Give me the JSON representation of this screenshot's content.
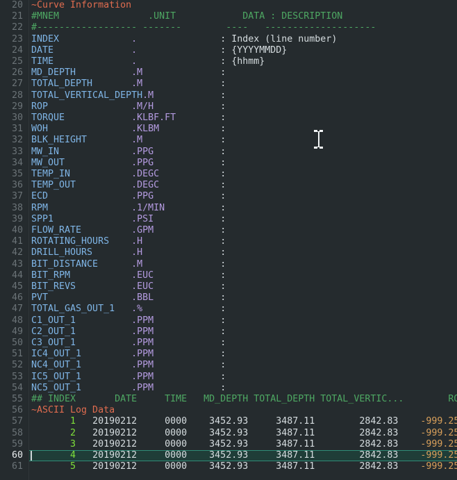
{
  "editor": {
    "theme": "dark",
    "background_color": "#252b2e",
    "gutter_color": "#6b7377",
    "active_line_number": 60,
    "active_line_bg": "#1f3d38",
    "active_line_border": "#2f8d78",
    "colors": {
      "section_header": "#e06c4f",
      "comment": "#4ea863",
      "mnemonic": "#7fb5e6",
      "unit": "#b49be0",
      "plain": "#d6dde0",
      "index_number": "#7ee03a",
      "null_value": "#d9a05b"
    },
    "mouse_cursor": "i-beam-text-cursor"
  },
  "lines": [
    {
      "n": 20,
      "segs": [
        {
          "c": "head",
          "t": "~Curve Information"
        }
      ]
    },
    {
      "n": 21,
      "segs": [
        {
          "c": "comment",
          "t": "#MNEM                .UNIT            DATA : DESCRIPTION"
        }
      ]
    },
    {
      "n": 22,
      "segs": [
        {
          "c": "comment",
          "t": "#------------------ -------        ----   --------------------"
        }
      ]
    },
    {
      "n": 23,
      "segs": [
        {
          "c": "mnem",
          "t": "INDEX             "
        },
        {
          "c": "unit",
          "t": "."
        },
        {
          "c": "plain",
          "t": "               : Index (line number)"
        }
      ]
    },
    {
      "n": 24,
      "segs": [
        {
          "c": "mnem",
          "t": "DATE              "
        },
        {
          "c": "unit",
          "t": "."
        },
        {
          "c": "plain",
          "t": "               : {YYYYMMDD}"
        }
      ]
    },
    {
      "n": 25,
      "segs": [
        {
          "c": "mnem",
          "t": "TIME              "
        },
        {
          "c": "unit",
          "t": "."
        },
        {
          "c": "plain",
          "t": "               : {hhmm}"
        }
      ]
    },
    {
      "n": 26,
      "segs": [
        {
          "c": "mnem",
          "t": "MD_DEPTH          "
        },
        {
          "c": "unit",
          "t": ".M"
        },
        {
          "c": "plain",
          "t": "              :"
        }
      ]
    },
    {
      "n": 27,
      "segs": [
        {
          "c": "mnem",
          "t": "TOTAL_DEPTH       "
        },
        {
          "c": "unit",
          "t": ".M"
        },
        {
          "c": "plain",
          "t": "              :"
        }
      ]
    },
    {
      "n": 28,
      "segs": [
        {
          "c": "mnem",
          "t": "TOTAL_VERTICAL_DEPTH"
        },
        {
          "c": "unit",
          "t": ".M"
        },
        {
          "c": "plain",
          "t": "            :"
        }
      ]
    },
    {
      "n": 29,
      "segs": [
        {
          "c": "mnem",
          "t": "ROP               "
        },
        {
          "c": "unit",
          "t": ".M/H"
        },
        {
          "c": "plain",
          "t": "            :"
        }
      ]
    },
    {
      "n": 30,
      "segs": [
        {
          "c": "mnem",
          "t": "TORQUE            "
        },
        {
          "c": "unit",
          "t": ".KLBF.FT"
        },
        {
          "c": "plain",
          "t": "        :"
        }
      ]
    },
    {
      "n": 31,
      "segs": [
        {
          "c": "mnem",
          "t": "WOH               "
        },
        {
          "c": "unit",
          "t": ".KLBM"
        },
        {
          "c": "plain",
          "t": "           :"
        }
      ]
    },
    {
      "n": 32,
      "segs": [
        {
          "c": "mnem",
          "t": "BLK_HEIGHT        "
        },
        {
          "c": "unit",
          "t": ".M"
        },
        {
          "c": "plain",
          "t": "              :"
        }
      ]
    },
    {
      "n": 33,
      "segs": [
        {
          "c": "mnem",
          "t": "MW_IN             "
        },
        {
          "c": "unit",
          "t": ".PPG"
        },
        {
          "c": "plain",
          "t": "            :"
        }
      ]
    },
    {
      "n": 34,
      "segs": [
        {
          "c": "mnem",
          "t": "MW_OUT            "
        },
        {
          "c": "unit",
          "t": ".PPG"
        },
        {
          "c": "plain",
          "t": "            :"
        }
      ]
    },
    {
      "n": 35,
      "segs": [
        {
          "c": "mnem",
          "t": "TEMP_IN           "
        },
        {
          "c": "unit",
          "t": ".DEGC"
        },
        {
          "c": "plain",
          "t": "           :"
        }
      ]
    },
    {
      "n": 36,
      "segs": [
        {
          "c": "mnem",
          "t": "TEMP_OUT          "
        },
        {
          "c": "unit",
          "t": ".DEGC"
        },
        {
          "c": "plain",
          "t": "           :"
        }
      ]
    },
    {
      "n": 37,
      "segs": [
        {
          "c": "mnem",
          "t": "ECD               "
        },
        {
          "c": "unit",
          "t": ".PPG"
        },
        {
          "c": "plain",
          "t": "            :"
        }
      ]
    },
    {
      "n": 38,
      "segs": [
        {
          "c": "mnem",
          "t": "RPM               "
        },
        {
          "c": "unit",
          "t": ".1/MIN"
        },
        {
          "c": "plain",
          "t": "          :"
        }
      ]
    },
    {
      "n": 39,
      "segs": [
        {
          "c": "mnem",
          "t": "SPP1              "
        },
        {
          "c": "unit",
          "t": ".PSI"
        },
        {
          "c": "plain",
          "t": "            :"
        }
      ]
    },
    {
      "n": 40,
      "segs": [
        {
          "c": "mnem",
          "t": "FLOW_RATE         "
        },
        {
          "c": "unit",
          "t": ".GPM"
        },
        {
          "c": "plain",
          "t": "            :"
        }
      ]
    },
    {
      "n": 41,
      "segs": [
        {
          "c": "mnem",
          "t": "ROTATING_HOURS    "
        },
        {
          "c": "unit",
          "t": ".H"
        },
        {
          "c": "plain",
          "t": "              :"
        }
      ]
    },
    {
      "n": 42,
      "segs": [
        {
          "c": "mnem",
          "t": "DRILL_HOURS       "
        },
        {
          "c": "unit",
          "t": ".H"
        },
        {
          "c": "plain",
          "t": "              :"
        }
      ]
    },
    {
      "n": 43,
      "segs": [
        {
          "c": "mnem",
          "t": "BIT_DISTANCE      "
        },
        {
          "c": "unit",
          "t": ".M"
        },
        {
          "c": "plain",
          "t": "              :"
        }
      ]
    },
    {
      "n": 44,
      "segs": [
        {
          "c": "mnem",
          "t": "BIT_RPM           "
        },
        {
          "c": "unit",
          "t": ".EUC"
        },
        {
          "c": "plain",
          "t": "            :"
        }
      ]
    },
    {
      "n": 45,
      "segs": [
        {
          "c": "mnem",
          "t": "BIT_REVS          "
        },
        {
          "c": "unit",
          "t": ".EUC"
        },
        {
          "c": "plain",
          "t": "            :"
        }
      ]
    },
    {
      "n": 46,
      "segs": [
        {
          "c": "mnem",
          "t": "PVT               "
        },
        {
          "c": "unit",
          "t": ".BBL"
        },
        {
          "c": "plain",
          "t": "            :"
        }
      ]
    },
    {
      "n": 47,
      "segs": [
        {
          "c": "mnem",
          "t": "TOTAL_GAS_OUT_1   "
        },
        {
          "c": "unit",
          "t": ".%"
        },
        {
          "c": "plain",
          "t": "              :"
        }
      ]
    },
    {
      "n": 48,
      "segs": [
        {
          "c": "mnem",
          "t": "C1_OUT_1          "
        },
        {
          "c": "unit",
          "t": ".PPM"
        },
        {
          "c": "plain",
          "t": "            :"
        }
      ]
    },
    {
      "n": 49,
      "segs": [
        {
          "c": "mnem",
          "t": "C2_OUT_1          "
        },
        {
          "c": "unit",
          "t": ".PPM"
        },
        {
          "c": "plain",
          "t": "            :"
        }
      ]
    },
    {
      "n": 50,
      "segs": [
        {
          "c": "mnem",
          "t": "C3_OUT_1          "
        },
        {
          "c": "unit",
          "t": ".PPM"
        },
        {
          "c": "plain",
          "t": "            :"
        }
      ]
    },
    {
      "n": 51,
      "segs": [
        {
          "c": "mnem",
          "t": "IC4_OUT_1         "
        },
        {
          "c": "unit",
          "t": ".PPM"
        },
        {
          "c": "plain",
          "t": "            :"
        }
      ]
    },
    {
      "n": 52,
      "segs": [
        {
          "c": "mnem",
          "t": "NC4_OUT_1         "
        },
        {
          "c": "unit",
          "t": ".PPM"
        },
        {
          "c": "plain",
          "t": "            :"
        }
      ]
    },
    {
      "n": 53,
      "segs": [
        {
          "c": "mnem",
          "t": "IC5_OUT_1         "
        },
        {
          "c": "unit",
          "t": ".PPM"
        },
        {
          "c": "plain",
          "t": "            :"
        }
      ]
    },
    {
      "n": 54,
      "segs": [
        {
          "c": "mnem",
          "t": "NC5_OUT_1         "
        },
        {
          "c": "unit",
          "t": ".PPM"
        },
        {
          "c": "plain",
          "t": "            :"
        }
      ]
    },
    {
      "n": 55,
      "segs": [
        {
          "c": "comment",
          "t": "## INDEX       DATE     TIME   MD_DEPTH TOTAL_DEPTH TOTAL_VERTIC...        ROP"
        }
      ]
    },
    {
      "n": 56,
      "segs": [
        {
          "c": "head",
          "t": "~ASCII Log Data"
        }
      ]
    },
    {
      "n": 57,
      "segs": [
        {
          "c": "green",
          "t": "       1"
        },
        {
          "c": "plain",
          "t": "   20190212     0000    3452.93     3487.11        2842.83    "
        },
        {
          "c": "num",
          "t": "-999.25"
        }
      ]
    },
    {
      "n": 58,
      "segs": [
        {
          "c": "green",
          "t": "       2"
        },
        {
          "c": "plain",
          "t": "   20190212     0000    3452.93     3487.11        2842.83    "
        },
        {
          "c": "num",
          "t": "-999.25"
        }
      ]
    },
    {
      "n": 59,
      "segs": [
        {
          "c": "green",
          "t": "       3"
        },
        {
          "c": "plain",
          "t": "   20190212     0000    3452.93     3487.11        2842.83    "
        },
        {
          "c": "num",
          "t": "-999.25"
        }
      ]
    },
    {
      "n": 60,
      "active": true,
      "segs": [
        {
          "c": "green",
          "t": "       4"
        },
        {
          "c": "plain",
          "t": "   20190212     0000    3452.93     3487.11        2842.83    "
        },
        {
          "c": "num",
          "t": "-999.25"
        }
      ]
    },
    {
      "n": 61,
      "segs": [
        {
          "c": "green",
          "t": "       5"
        },
        {
          "c": "plain",
          "t": "   20190212     0000    3452.93     3487.11        2842.83    "
        },
        {
          "c": "num",
          "t": "-999.25"
        }
      ]
    }
  ],
  "las_content": {
    "section": "~Curve Information",
    "header_row": {
      "mnem": "#MNEM",
      "unit": ".UNIT",
      "data": "DATA",
      "colon": ":",
      "description": "DESCRIPTION"
    },
    "curves": [
      {
        "mnemonic": "INDEX",
        "unit": ".",
        "description": "Index (line number)"
      },
      {
        "mnemonic": "DATE",
        "unit": ".",
        "description": "{YYYYMMDD}"
      },
      {
        "mnemonic": "TIME",
        "unit": ".",
        "description": "{hhmm}"
      },
      {
        "mnemonic": "MD_DEPTH",
        "unit": ".M",
        "description": ""
      },
      {
        "mnemonic": "TOTAL_DEPTH",
        "unit": ".M",
        "description": ""
      },
      {
        "mnemonic": "TOTAL_VERTICAL_DEPTH",
        "unit": ".M",
        "description": ""
      },
      {
        "mnemonic": "ROP",
        "unit": ".M/H",
        "description": ""
      },
      {
        "mnemonic": "TORQUE",
        "unit": ".KLBF.FT",
        "description": ""
      },
      {
        "mnemonic": "WOH",
        "unit": ".KLBM",
        "description": ""
      },
      {
        "mnemonic": "BLK_HEIGHT",
        "unit": ".M",
        "description": ""
      },
      {
        "mnemonic": "MW_IN",
        "unit": ".PPG",
        "description": ""
      },
      {
        "mnemonic": "MW_OUT",
        "unit": ".PPG",
        "description": ""
      },
      {
        "mnemonic": "TEMP_IN",
        "unit": ".DEGC",
        "description": ""
      },
      {
        "mnemonic": "TEMP_OUT",
        "unit": ".DEGC",
        "description": ""
      },
      {
        "mnemonic": "ECD",
        "unit": ".PPG",
        "description": ""
      },
      {
        "mnemonic": "RPM",
        "unit": ".1/MIN",
        "description": ""
      },
      {
        "mnemonic": "SPP1",
        "unit": ".PSI",
        "description": ""
      },
      {
        "mnemonic": "FLOW_RATE",
        "unit": ".GPM",
        "description": ""
      },
      {
        "mnemonic": "ROTATING_HOURS",
        "unit": ".H",
        "description": ""
      },
      {
        "mnemonic": "DRILL_HOURS",
        "unit": ".H",
        "description": ""
      },
      {
        "mnemonic": "BIT_DISTANCE",
        "unit": ".M",
        "description": ""
      },
      {
        "mnemonic": "BIT_RPM",
        "unit": ".EUC",
        "description": ""
      },
      {
        "mnemonic": "BIT_REVS",
        "unit": ".EUC",
        "description": ""
      },
      {
        "mnemonic": "PVT",
        "unit": ".BBL",
        "description": ""
      },
      {
        "mnemonic": "TOTAL_GAS_OUT_1",
        "unit": ".%",
        "description": ""
      },
      {
        "mnemonic": "C1_OUT_1",
        "unit": ".PPM",
        "description": ""
      },
      {
        "mnemonic": "C2_OUT_1",
        "unit": ".PPM",
        "description": ""
      },
      {
        "mnemonic": "C3_OUT_1",
        "unit": ".PPM",
        "description": ""
      },
      {
        "mnemonic": "IC4_OUT_1",
        "unit": ".PPM",
        "description": ""
      },
      {
        "mnemonic": "NC4_OUT_1",
        "unit": ".PPM",
        "description": ""
      },
      {
        "mnemonic": "IC5_OUT_1",
        "unit": ".PPM",
        "description": ""
      },
      {
        "mnemonic": "NC5_OUT_1",
        "unit": ".PPM",
        "description": ""
      }
    ],
    "ascii_section": "~ASCII Log Data",
    "data_columns": [
      "## INDEX",
      "DATE",
      "TIME",
      "MD_DEPTH",
      "TOTAL_DEPTH",
      "TOTAL_VERTIC...",
      "ROP"
    ],
    "data_rows": [
      [
        "1",
        "20190212",
        "0000",
        "3452.93",
        "3487.11",
        "2842.83",
        "-999.25"
      ],
      [
        "2",
        "20190212",
        "0000",
        "3452.93",
        "3487.11",
        "2842.83",
        "-999.25"
      ],
      [
        "3",
        "20190212",
        "0000",
        "3452.93",
        "3487.11",
        "2842.83",
        "-999.25"
      ],
      [
        "4",
        "20190212",
        "0000",
        "3452.93",
        "3487.11",
        "2842.83",
        "-999.25"
      ],
      [
        "5",
        "20190212",
        "0000",
        "3452.93",
        "3487.11",
        "2842.83",
        "-999.25"
      ]
    ]
  }
}
